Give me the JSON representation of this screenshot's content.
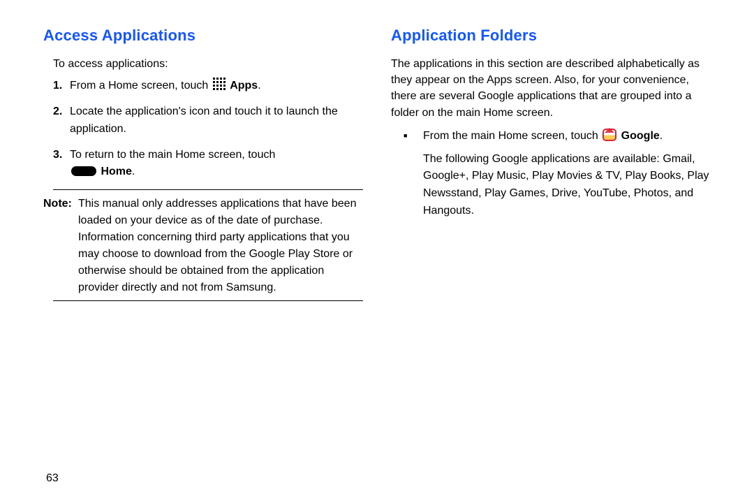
{
  "page_number": "63",
  "left": {
    "heading": "Access Applications",
    "intro": "To access applications:",
    "steps": {
      "s1_num": "1.",
      "s1_a": "From a Home screen, touch ",
      "s1_b": " Apps",
      "s1_c": ".",
      "s2_num": "2.",
      "s2": "Locate the application's icon and touch it to launch the application.",
      "s3_num": "3.",
      "s3_a": "To return to the main Home screen, touch ",
      "s3_b": " Home",
      "s3_c": "."
    },
    "note_label": "Note:",
    "note_body": "This manual only addresses applications that have been loaded on your device as of the date of purchase. Information concerning third party applications that you may choose to download from the Google Play Store or otherwise should be obtained from the application provider directly and not from Samsung."
  },
  "right": {
    "heading": "Application Folders",
    "intro": "The applications in this section are described alphabetically as they appear on the Apps screen. Also, for your convenience, there are several Google applications that are grouped into a folder on the main Home screen.",
    "bullet_a": "From the main Home screen, touch ",
    "bullet_b": " Google",
    "bullet_c": ".",
    "bullet_p2": "The following Google applications are available: Gmail, Google+, Play Music, Play Movies & TV, Play Books, Play Newsstand, Play Games, Drive, YouTube, Photos, and Hangouts."
  }
}
